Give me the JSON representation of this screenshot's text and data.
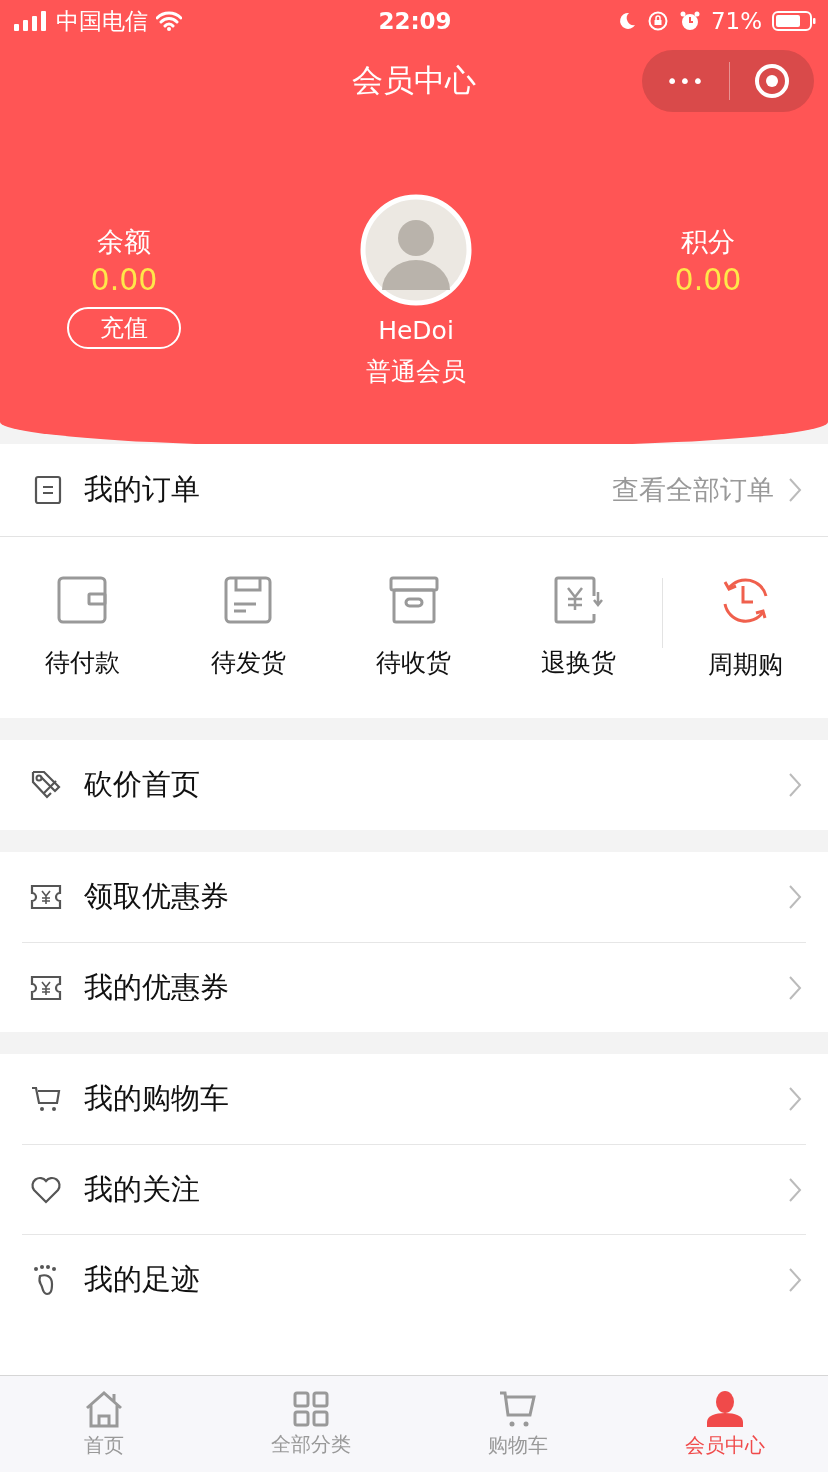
{
  "status_bar": {
    "carrier": "中国电信",
    "time": "22:09",
    "battery": "71%"
  },
  "nav": {
    "title": "会员中心",
    "more": "•••"
  },
  "header": {
    "balance": {
      "label": "余额",
      "value": "0.00",
      "button": "充值"
    },
    "user": {
      "name": "HeDoi",
      "level": "普通会员"
    },
    "points": {
      "label": "积分",
      "value": "0.00"
    }
  },
  "orders": {
    "title": "我的订单",
    "link": "查看全部订单",
    "statuses": [
      {
        "kind": "wallet",
        "label": "待付款"
      },
      {
        "kind": "package",
        "label": "待发货"
      },
      {
        "kind": "box",
        "label": "待收货"
      },
      {
        "kind": "refund",
        "label": "退换货"
      },
      {
        "kind": "cycle",
        "label": "周期购"
      }
    ]
  },
  "menu_groups": [
    [
      {
        "kind": "tag",
        "label": "砍价首页"
      }
    ],
    [
      {
        "kind": "coupon",
        "label": "领取优惠券"
      },
      {
        "kind": "coupon",
        "label": "我的优惠券"
      }
    ],
    [
      {
        "kind": "cart",
        "label": "我的购物车"
      },
      {
        "kind": "heart",
        "label": "我的关注"
      },
      {
        "kind": "foot",
        "label": "我的足迹"
      }
    ]
  ],
  "tabs": [
    {
      "kind": "home",
      "label": "首页",
      "selected": false
    },
    {
      "kind": "grid",
      "label": "全部分类",
      "selected": false
    },
    {
      "kind": "cart",
      "label": "购物车",
      "selected": false
    },
    {
      "kind": "user",
      "label": "会员中心",
      "selected": true
    }
  ]
}
